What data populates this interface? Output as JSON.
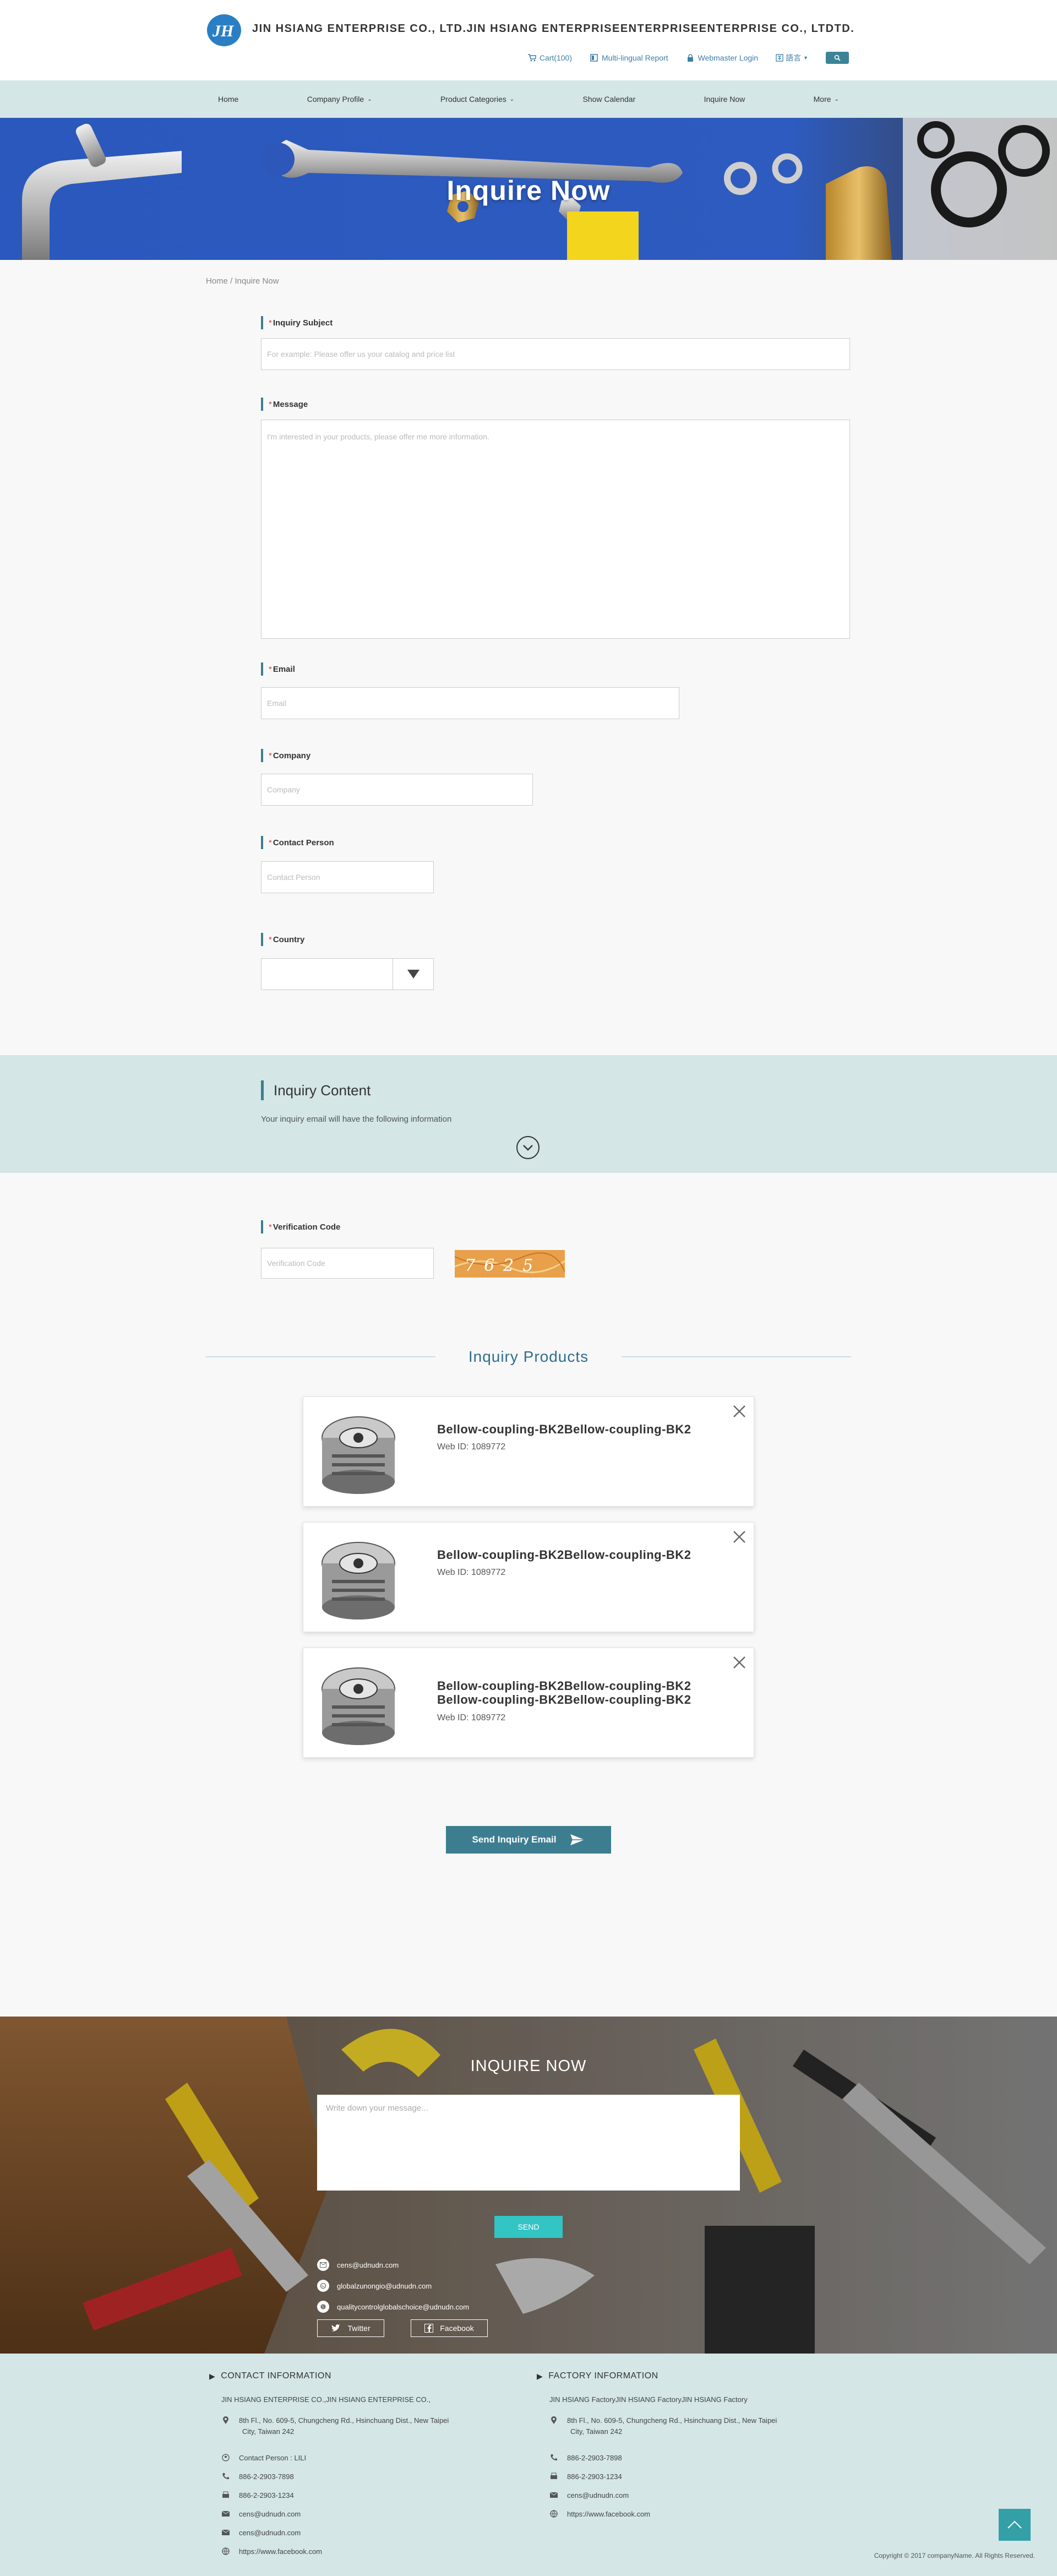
{
  "header": {
    "company_name": "JIN HSIANG ENTERPRISE CO., LTD.JIN HSIANG ENTERPRISEENTERPRISEENTERPRISE CO., LTDTD.",
    "logo_text": "JH",
    "cart": "Cart(100)",
    "multilingual": "Multi-lingual Report",
    "webmaster": "Webmaster Login",
    "lang_selected": "語言"
  },
  "nav": {
    "items": [
      {
        "label": "Home"
      },
      {
        "label": "Company Profile"
      },
      {
        "label": "Product Categories"
      },
      {
        "label": "Show Calendar"
      },
      {
        "label": "Inquire Now"
      },
      {
        "label": "More"
      }
    ]
  },
  "banner": {
    "title": "Inquire Now"
  },
  "breadcrumb": "Home / Inquire Now",
  "form": {
    "required_mark": "*",
    "subject_label": "Inquiry Subject",
    "subject_placeholder": "For example: Please offer us your catalog and price list",
    "message_label": "Message",
    "message_placeholder": "I'm interested in your products, please offer me more information.",
    "email_label": "Email",
    "email_placeholder": "Email",
    "company_label": "Company",
    "company_placeholder": "Company",
    "contact_label": "Contact Person",
    "contact_placeholder": "Contact Person",
    "country_label": "Country",
    "country_value": ""
  },
  "inquiry_content": {
    "title": "Inquiry Content",
    "subtitle": "Your inquiry email will have the following information"
  },
  "verification": {
    "label": "Verification Code",
    "placeholder": "Verification Code",
    "captcha_text": "7625"
  },
  "products": {
    "heading": "Inquiry Products",
    "items": [
      {
        "name": "Bellow-coupling-BK2Bellow-coupling-BK2",
        "web_id": "Web ID: 1089772"
      },
      {
        "name": "Bellow-coupling-BK2Bellow-coupling-BK2",
        "web_id": "Web ID: 1089772"
      },
      {
        "name": "Bellow-coupling-BK2Bellow-coupling-BK2 Bellow-coupling-BK2Bellow-coupling-BK2",
        "web_id": "Web ID: 1089772"
      }
    ]
  },
  "send_button": "Send Inquiry Email",
  "quick_inquiry": {
    "title": "INQUIRE NOW",
    "placeholder": "Write down your message...",
    "send": "SEND",
    "contacts": [
      "cens@udnudn.com",
      "globalzunongio@udnudn.com",
      "qualitycontrolglobalschoice@udnudn.com"
    ],
    "twitter": "Twitter",
    "facebook": "Facebook"
  },
  "footer": {
    "contact_title": "CONTACT INFORMATION",
    "contact": {
      "company": "JIN HSIANG ENTERPRISE CO.,JIN HSIANG ENTERPRISE CO.,",
      "address_line1": "8th Fl., No. 609-5, Chungcheng Rd., Hsinchuang Dist., New Taipei",
      "address_line2": "City, Taiwan 242",
      "person": "Contact Person : LILI",
      "phone1": "886-2-2903-7898",
      "phone2": "886-2-2903-1234",
      "email1": "cens@udnudn.com",
      "email2": "cens@udnudn.com",
      "url": "https://www.facebook.com"
    },
    "factory_title": "FACTORY INFORMATION",
    "factory": {
      "name": "JIN HSIANG FactoryJIN HSIANG FactoryJIN HSIANG Factory",
      "address_line1": "8th Fl., No. 609-5, Chungcheng Rd., Hsinchuang Dist., New Taipei",
      "address_line2": "City, Taiwan 242",
      "phone1": "886-2-2903-7898",
      "fax": "886-2-2903-1234",
      "email": "cens@udnudn.com",
      "url": "https://www.facebook.com"
    },
    "copyright": "Copyright © 2017 companyName. All Rights Reserved."
  },
  "colors": {
    "accent": "#3c7e90",
    "nav_bg": "#d4e6e6",
    "link": "#3d7fa8",
    "send_cyan": "#33c4c4"
  }
}
